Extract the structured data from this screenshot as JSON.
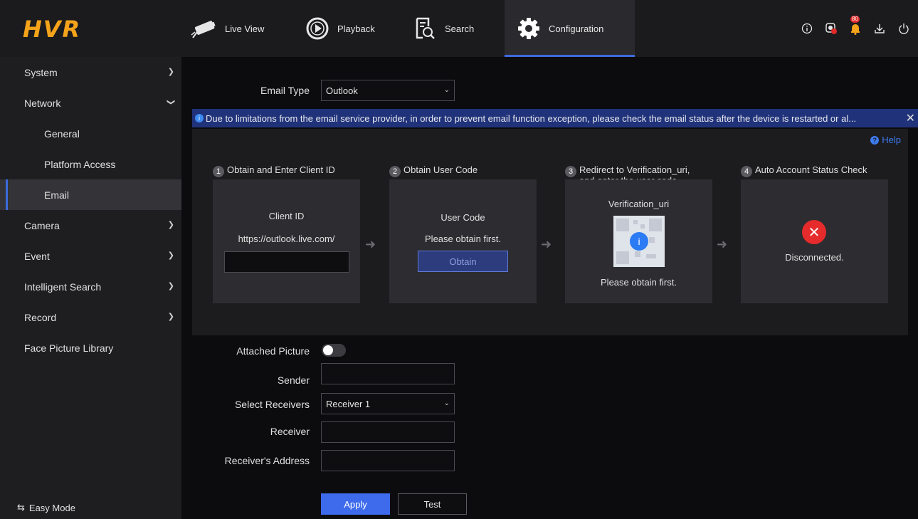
{
  "header": {
    "logo": "HVR",
    "tabs": [
      {
        "label": "Live View"
      },
      {
        "label": "Playback"
      },
      {
        "label": "Search"
      },
      {
        "label": "Configuration"
      }
    ],
    "alarm_count": "80"
  },
  "sidebar": {
    "items": [
      {
        "label": "System"
      },
      {
        "label": "Network"
      },
      {
        "label": "General"
      },
      {
        "label": "Platform Access"
      },
      {
        "label": "Email"
      },
      {
        "label": "Camera"
      },
      {
        "label": "Event"
      },
      {
        "label": "Intelligent Search"
      },
      {
        "label": "Record"
      },
      {
        "label": "Face Picture Library"
      }
    ],
    "easy_mode": "Easy Mode"
  },
  "form": {
    "email_type_label": "Email Type",
    "email_type_value": "Outlook",
    "notice": "Due to limitations from the email service provider, in order to prevent email function exception, please check the email status after the device is restarted or al...",
    "help": "Help",
    "steps": [
      {
        "num": "1",
        "title": "Obtain and Enter Client ID"
      },
      {
        "num": "2",
        "title": "Obtain User Code"
      },
      {
        "num": "3",
        "title": "Redirect to Verification_uri, and enter the user code"
      },
      {
        "num": "4",
        "title": "Auto Account Status Check"
      }
    ],
    "client_id_label": "Client ID",
    "client_id_url": "https://outlook.live.com/",
    "user_code_label": "User Code",
    "user_code_status": "Please obtain first.",
    "obtain_button": "Obtain",
    "verification_label": "Verification_uri",
    "verification_status": "Please obtain first.",
    "account_status": "Disconnected.",
    "attached_picture_label": "Attached Picture",
    "sender_label": "Sender",
    "select_receivers_label": "Select Receivers",
    "select_receivers_value": "Receiver 1",
    "receiver_label": "Receiver",
    "receiver_address_label": "Receiver's Address",
    "apply_button": "Apply",
    "test_button": "Test"
  }
}
